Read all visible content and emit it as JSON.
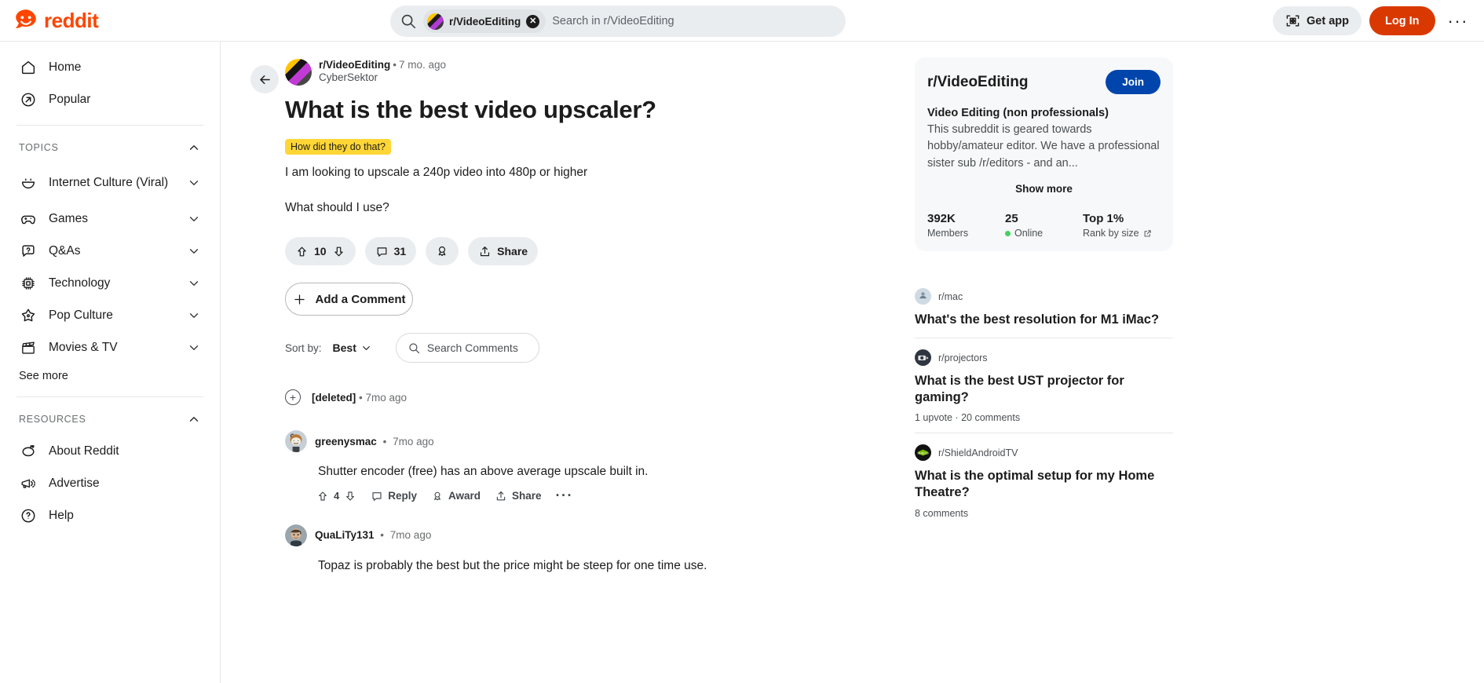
{
  "header": {
    "logo_text": "reddit",
    "logo_icon": "reddit-logo-icon",
    "search": {
      "icon": "search-icon",
      "chip_label": "r/VideoEditing",
      "chip_clear_icon": "close-icon",
      "placeholder": "Search in r/VideoEditing",
      "value": ""
    },
    "get_app_label": "Get app",
    "get_app_icon": "qr-code-icon",
    "login_label": "Log In",
    "overflow_icon": "kebab-menu-icon"
  },
  "sidebar": {
    "primary": [
      {
        "label": "Home",
        "icon": "home-icon"
      },
      {
        "label": "Popular",
        "icon": "arrow-up-right-circle-icon"
      }
    ],
    "topics_header": "TOPICS",
    "topics_chevron": "chevron-up-icon",
    "topics": [
      {
        "label": "Internet Culture (Viral)",
        "icon": "smiley-face-icon",
        "chevron": "chevron-down-icon"
      },
      {
        "label": "Games",
        "icon": "gamepad-icon",
        "chevron": "chevron-down-icon"
      },
      {
        "label": "Q&As",
        "icon": "question-bubble-icon",
        "chevron": "chevron-down-icon"
      },
      {
        "label": "Technology",
        "icon": "cpu-chip-icon",
        "chevron": "chevron-down-icon"
      },
      {
        "label": "Pop Culture",
        "icon": "star-icon",
        "chevron": "chevron-down-icon"
      },
      {
        "label": "Movies & TV",
        "icon": "clapperboard-icon",
        "chevron": "chevron-down-icon"
      }
    ],
    "see_more": "See more",
    "resources_header": "RESOURCES",
    "resources_chevron": "chevron-up-icon",
    "resources": [
      {
        "label": "About Reddit",
        "icon": "reddit-snoo-icon"
      },
      {
        "label": "Advertise",
        "icon": "megaphone-icon"
      },
      {
        "label": "Help",
        "icon": "question-circle-icon"
      }
    ]
  },
  "post": {
    "back_icon": "arrow-left-icon",
    "subreddit": "r/VideoEditing",
    "dot": "•",
    "time": "7 mo. ago",
    "author": "CyberSektor",
    "title": "What is the best video upscaler?",
    "flair": "How did they do that?",
    "body_1": "I am looking to upscale a 240p video into 480p or higher",
    "body_2": "What should I use?",
    "overflow_icon": "kebab-menu-icon",
    "actions": {
      "upvote_icon": "upvote-arrow-icon",
      "score": "10",
      "downvote_icon": "downvote-arrow-icon",
      "comment_icon": "comment-bubble-icon",
      "comment_count": "31",
      "award_icon": "award-rosette-icon",
      "share_icon": "share-icon",
      "share_label": "Share"
    },
    "add_comment_label": "Add a Comment",
    "add_comment_icon": "plus-icon"
  },
  "comments_toolbar": {
    "sort_by_label": "Sort by:",
    "sort_value": "Best",
    "sort_chevron": "chevron-down-icon",
    "search_icon": "search-icon",
    "search_placeholder": "Search Comments",
    "search_value": ""
  },
  "comments": [
    {
      "collapsed": true,
      "expand_icon": "plus-circle-icon",
      "author": "[deleted]",
      "dot": "•",
      "time": "7mo ago",
      "body": "",
      "actions": null
    },
    {
      "collapsed": false,
      "avatar": "user-avatar-greenysmac",
      "author": "greenysmac",
      "dot": "•",
      "time": "7mo ago",
      "body": "Shutter encoder (free) has an above average upscale built in.",
      "actions": {
        "upvote_icon": "upvote-arrow-icon",
        "score": "4",
        "downvote_icon": "downvote-arrow-icon",
        "reply_icon": "comment-bubble-icon",
        "reply_label": "Reply",
        "award_icon": "award-rosette-icon",
        "award_label": "Award",
        "share_icon": "share-icon",
        "share_label": "Share",
        "overflow_icon": "kebab-menu-icon"
      }
    },
    {
      "collapsed": false,
      "avatar": "user-avatar-quality131",
      "author": "QuaLiTy131",
      "dot": "•",
      "time": "7mo ago",
      "body": "Topaz is probably the best but the price might be steep for one time use.",
      "actions": null
    }
  ],
  "community_card": {
    "title": "r/VideoEditing",
    "join_label": "Join",
    "subtitle": "Video Editing (non professionals)",
    "description": "This subreddit is geared towards hobby/amateur editor. We have a professional sister sub /r/editors - and an...",
    "show_more": "Show more",
    "stats": [
      {
        "value": "392K",
        "label": "Members"
      },
      {
        "value": "25",
        "label": "Online",
        "dot": true
      },
      {
        "value": "Top 1%",
        "label": "Rank by size",
        "external_icon": "external-link-icon"
      }
    ]
  },
  "related_posts": [
    {
      "subreddit": "r/mac",
      "avatar_color": "#c8d4e0",
      "title": "What's the best resolution for M1 iMac?",
      "meta": ""
    },
    {
      "subreddit": "r/projectors",
      "avatar_color": "#2f3640",
      "title": "What is the best UST projector for gaming?",
      "meta": "1 upvote  ·  20 comments"
    },
    {
      "subreddit": "r/ShieldAndroidTV",
      "avatar_color": "#111111",
      "title": "What is the optimal setup for my Home Theatre?",
      "meta": "8 comments"
    }
  ]
}
